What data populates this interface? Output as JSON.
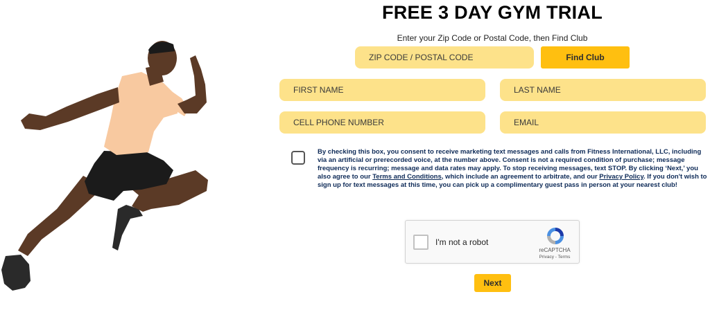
{
  "page": {
    "title": "FREE 3 DAY GYM TRIAL",
    "subtitle": "Enter your Zip Code or Postal Code, then Find Club"
  },
  "form": {
    "zip_placeholder": "ZIP CODE / POSTAL CODE",
    "find_club_label": "Find Club",
    "first_name_placeholder": "FIRST NAME",
    "last_name_placeholder": "LAST NAME",
    "phone_placeholder": "CELL PHONE NUMBER",
    "email_placeholder": "EMAIL",
    "consent": {
      "part1": "By checking this box, you consent to receive marketing text messages and calls from Fitness International, LLC, including via an artificial or prerecorded voice, at the number above. Consent is not a required condition of purchase; message frequency is recurring; message and data rates may apply. To stop receiving messages, text STOP. By clicking ‘Next,’ you also agree to our ",
      "terms_link": "Terms and Conditions",
      "part2": ", which include an agreement to arbitrate, and our ",
      "privacy_link": "Privacy Policy",
      "part3": ". If you don't wish to sign up for text messages at this time, you can pick up a complimentary guest pass in person at your nearest club!"
    },
    "next_label": "Next"
  },
  "recaptcha": {
    "label": "I'm not a robot",
    "brand": "reCAPTCHA",
    "links": "Privacy - Terms"
  },
  "colors": {
    "field_bg": "#fde28a",
    "button_bg": "#ffbf10",
    "consent_text": "#0d2a57"
  }
}
